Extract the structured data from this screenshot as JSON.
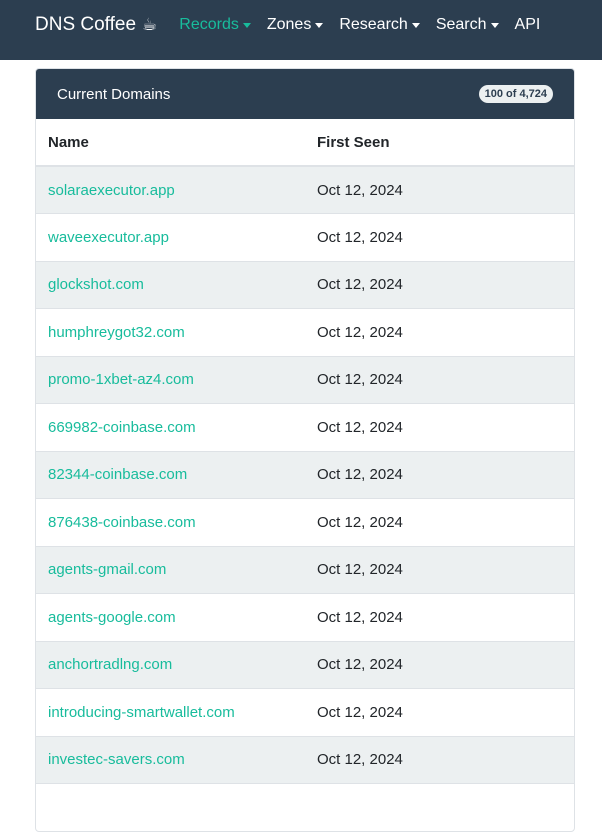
{
  "navbar": {
    "brand": "DNS Coffee",
    "brand_icon": "☕",
    "items": [
      {
        "label": "Records",
        "dropdown": true,
        "active": true
      },
      {
        "label": "Zones",
        "dropdown": true,
        "active": false
      },
      {
        "label": "Research",
        "dropdown": true,
        "active": false
      },
      {
        "label": "Search",
        "dropdown": true,
        "active": false
      },
      {
        "label": "API",
        "dropdown": false,
        "active": false
      }
    ]
  },
  "card": {
    "title": "Current Domains",
    "count_badge": "100 of 4,724"
  },
  "table": {
    "headers": [
      "Name",
      "First Seen"
    ],
    "rows": [
      {
        "name": "solaraexecutor.app",
        "first_seen": "Oct 12, 2024"
      },
      {
        "name": "waveexecutor.app",
        "first_seen": "Oct 12, 2024"
      },
      {
        "name": "glockshot.com",
        "first_seen": "Oct 12, 2024"
      },
      {
        "name": "humphreygot32.com",
        "first_seen": "Oct 12, 2024"
      },
      {
        "name": "promo-1xbet-az4.com",
        "first_seen": "Oct 12, 2024"
      },
      {
        "name": "669982-coinbase.com",
        "first_seen": "Oct 12, 2024"
      },
      {
        "name": "82344-coinbase.com",
        "first_seen": "Oct 12, 2024"
      },
      {
        "name": "876438-coinbase.com",
        "first_seen": "Oct 12, 2024"
      },
      {
        "name": "agents-gmail.com",
        "first_seen": "Oct 12, 2024"
      },
      {
        "name": "agents-google.com",
        "first_seen": "Oct 12, 2024"
      },
      {
        "name": "anchortradlng.com",
        "first_seen": "Oct 12, 2024"
      },
      {
        "name": "introducing-smartwallet.com",
        "first_seen": "Oct 12, 2024"
      },
      {
        "name": "investec-savers.com",
        "first_seen": "Oct 12, 2024"
      }
    ]
  },
  "colors": {
    "navbar_bg": "#2c3e50",
    "accent": "#18bc9c",
    "stripe": "#ecf0f1"
  }
}
